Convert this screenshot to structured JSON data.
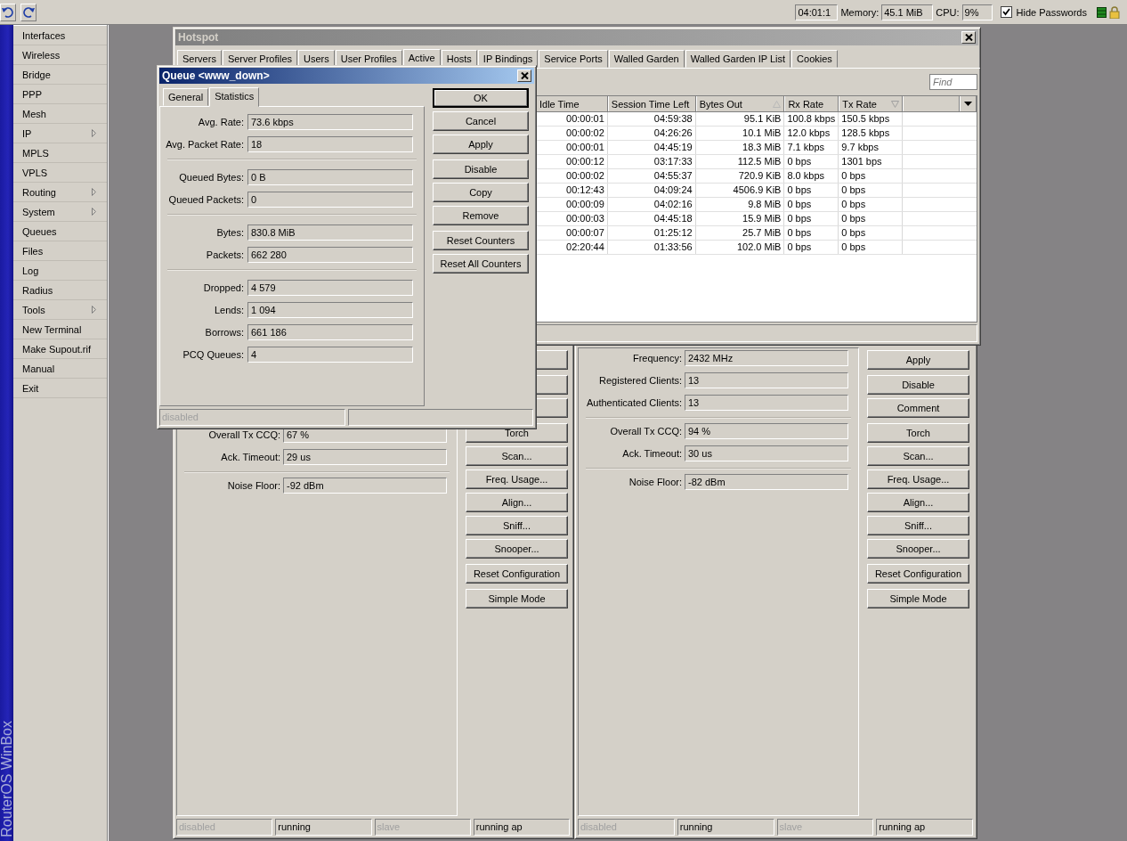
{
  "toolbar": {
    "time": "04:01:1",
    "memory_label": "Memory:",
    "memory": "45.1 MiB",
    "cpu_label": "CPU:",
    "cpu": "9%",
    "hide_passwords": {
      "label": "Hide Passwords",
      "checked": true
    }
  },
  "sidebar": {
    "brand": "RouterOS WinBox",
    "items": [
      {
        "label": "Interfaces",
        "has_submenu": false
      },
      {
        "label": "Wireless",
        "has_submenu": false
      },
      {
        "label": "Bridge",
        "has_submenu": false
      },
      {
        "label": "PPP",
        "has_submenu": false
      },
      {
        "label": "Mesh",
        "has_submenu": false
      },
      {
        "label": "IP",
        "has_submenu": true
      },
      {
        "label": "MPLS",
        "has_submenu": false
      },
      {
        "label": "VPLS",
        "has_submenu": false
      },
      {
        "label": "Routing",
        "has_submenu": true
      },
      {
        "label": "System",
        "has_submenu": true
      },
      {
        "label": "Queues",
        "has_submenu": false
      },
      {
        "label": "Files",
        "has_submenu": false
      },
      {
        "label": "Log",
        "has_submenu": false
      },
      {
        "label": "Radius",
        "has_submenu": false
      },
      {
        "label": "Tools",
        "has_submenu": true
      },
      {
        "label": "New Terminal",
        "has_submenu": false
      },
      {
        "label": "Make Supout.rif",
        "has_submenu": false
      },
      {
        "label": "Manual",
        "has_submenu": false
      },
      {
        "label": "Exit",
        "has_submenu": false
      }
    ]
  },
  "hotspot": {
    "title": "Hotspot",
    "tabs": [
      {
        "label": "Servers",
        "selected": false
      },
      {
        "label": "Server Profiles",
        "selected": false
      },
      {
        "label": "Users",
        "selected": false
      },
      {
        "label": "User Profiles",
        "selected": false
      },
      {
        "label": "Active",
        "selected": true
      },
      {
        "label": "Hosts",
        "selected": false
      },
      {
        "label": "IP Bindings",
        "selected": false
      },
      {
        "label": "Service Ports",
        "selected": false
      },
      {
        "label": "Walled Garden",
        "selected": false
      },
      {
        "label": "Walled Garden IP List",
        "selected": false
      },
      {
        "label": "Cookies",
        "selected": false
      }
    ],
    "find": {
      "placeholder": "Find"
    },
    "table": {
      "columns": [
        {
          "label": "Idle Time",
          "kind": "plain"
        },
        {
          "label": "Session Time Left",
          "kind": "plain"
        },
        {
          "label": "Bytes Out",
          "kind": "sorted-ascending"
        },
        {
          "label": "Rx Rate",
          "kind": "plain"
        },
        {
          "label": "Tx Rate",
          "kind": "sorted-descending"
        }
      ],
      "rows": [
        [
          "00:00:01",
          "04:59:38",
          "95.1 KiB",
          "100.8 kbps",
          "150.5 kbps"
        ],
        [
          "00:00:02",
          "04:26:26",
          "10.1 MiB",
          "12.0 kbps",
          "128.5 kbps"
        ],
        [
          "00:00:01",
          "04:45:19",
          "18.3 MiB",
          "7.1 kbps",
          "9.7 kbps"
        ],
        [
          "00:00:12",
          "03:17:33",
          "112.5 MiB",
          "0 bps",
          "1301 bps"
        ],
        [
          "00:00:02",
          "04:55:37",
          "720.9 KiB",
          "8.0 kbps",
          "0 bps"
        ],
        [
          "00:12:43",
          "04:09:24",
          "4506.9 KiB",
          "0 bps",
          "0 bps"
        ],
        [
          "00:00:09",
          "04:02:16",
          "9.8 MiB",
          "0 bps",
          "0 bps"
        ],
        [
          "00:00:03",
          "04:45:18",
          "15.9 MiB",
          "0 bps",
          "0 bps"
        ],
        [
          "00:00:07",
          "01:25:12",
          "25.7 MiB",
          "0 bps",
          "0 bps"
        ],
        [
          "02:20:44",
          "01:33:56",
          "102.0 MiB",
          "0 bps",
          "0 bps"
        ]
      ]
    }
  },
  "wireless_windows": [
    {
      "field_groups": [
        {
          "kind": "covered"
        },
        {
          "kind": "fields",
          "fields": [
            {
              "label": "Overall Tx CCQ:",
              "value": "67 %"
            },
            {
              "label": "Ack. Timeout:",
              "value": "29 us"
            }
          ]
        },
        {
          "kind": "fields",
          "fields": [
            {
              "label": "Noise Floor:",
              "value": "-92 dBm"
            }
          ]
        }
      ],
      "button_groups": [
        [
          {
            "kind": "covered"
          }
        ],
        [
          {
            "kind": "covered"
          },
          {
            "kind": "covered"
          }
        ],
        [
          {
            "kind": "button",
            "label": "Torch"
          },
          {
            "kind": "button",
            "label": "Scan..."
          },
          {
            "kind": "button",
            "label": "Freq. Usage..."
          },
          {
            "kind": "button",
            "label": "Align..."
          },
          {
            "kind": "button",
            "label": "Sniff..."
          },
          {
            "kind": "button",
            "label": "Snooper..."
          }
        ],
        [
          {
            "kind": "button",
            "label": "Reset Configuration"
          }
        ],
        [
          {
            "kind": "button",
            "label": "Simple Mode"
          }
        ]
      ],
      "status_cells": [
        {
          "text": "disabled",
          "greyed": true
        },
        {
          "text": "running",
          "greyed": false
        },
        {
          "text": "slave",
          "greyed": true
        },
        {
          "text": "running ap",
          "greyed": false
        }
      ]
    },
    {
      "field_groups": [
        {
          "kind": "fields",
          "fields": [
            {
              "label": "Frequency:",
              "value": "2432 MHz"
            },
            {
              "label": "Registered Clients:",
              "value": "13"
            },
            {
              "label": "Authenticated Clients:",
              "value": "13"
            }
          ]
        },
        {
          "kind": "fields",
          "fields": [
            {
              "label": "Overall Tx CCQ:",
              "value": "94 %"
            },
            {
              "label": "Ack. Timeout:",
              "value": "30 us"
            }
          ]
        },
        {
          "kind": "fields",
          "fields": [
            {
              "label": "Noise Floor:",
              "value": "-82 dBm"
            }
          ]
        }
      ],
      "button_groups": [
        [
          {
            "kind": "button",
            "label": "Apply"
          }
        ],
        [
          {
            "kind": "button",
            "label": "Disable"
          },
          {
            "kind": "button",
            "label": "Comment"
          }
        ],
        [
          {
            "kind": "button",
            "label": "Torch"
          },
          {
            "kind": "button",
            "label": "Scan..."
          },
          {
            "kind": "button",
            "label": "Freq. Usage..."
          },
          {
            "kind": "button",
            "label": "Align..."
          },
          {
            "kind": "button",
            "label": "Sniff..."
          },
          {
            "kind": "button",
            "label": "Snooper..."
          }
        ],
        [
          {
            "kind": "button",
            "label": "Reset Configuration"
          }
        ],
        [
          {
            "kind": "button",
            "label": "Simple Mode"
          }
        ]
      ],
      "status_cells": [
        {
          "text": "disabled",
          "greyed": true
        },
        {
          "text": "running",
          "greyed": false
        },
        {
          "text": "slave",
          "greyed": true
        },
        {
          "text": "running ap",
          "greyed": false
        }
      ]
    }
  ],
  "queue_dialog": {
    "title": "Queue <www_down>",
    "tabs": [
      {
        "label": "General",
        "selected": false
      },
      {
        "label": "Statistics",
        "selected": true
      }
    ],
    "field_groups": [
      [
        {
          "label": "Avg. Rate:",
          "value": "73.6 kbps"
        },
        {
          "label": "Avg. Packet Rate:",
          "value": "18"
        }
      ],
      [
        {
          "label": "Queued Bytes:",
          "value": "0 B"
        },
        {
          "label": "Queued Packets:",
          "value": "0"
        }
      ],
      [
        {
          "label": "Bytes:",
          "value": "830.8 MiB"
        },
        {
          "label": "Packets:",
          "value": "662 280"
        }
      ],
      [
        {
          "label": "Dropped:",
          "value": "4 579"
        },
        {
          "label": "Lends:",
          "value": "1 094"
        },
        {
          "label": "Borrows:",
          "value": "661 186"
        },
        {
          "label": "PCQ Queues:",
          "value": "4"
        }
      ]
    ],
    "button_groups": [
      [
        {
          "label": "OK",
          "default": true
        },
        {
          "label": "Cancel",
          "default": false
        },
        {
          "label": "Apply",
          "default": false
        }
      ],
      [
        {
          "label": "Disable",
          "default": false
        },
        {
          "label": "Copy",
          "default": false
        },
        {
          "label": "Remove",
          "default": false
        }
      ],
      [
        {
          "label": "Reset Counters",
          "default": false
        },
        {
          "label": "Reset All Counters",
          "default": false
        }
      ]
    ],
    "status_cells": [
      {
        "kind": "text",
        "text": "disabled",
        "greyed": true
      },
      {
        "kind": "blank"
      }
    ]
  }
}
